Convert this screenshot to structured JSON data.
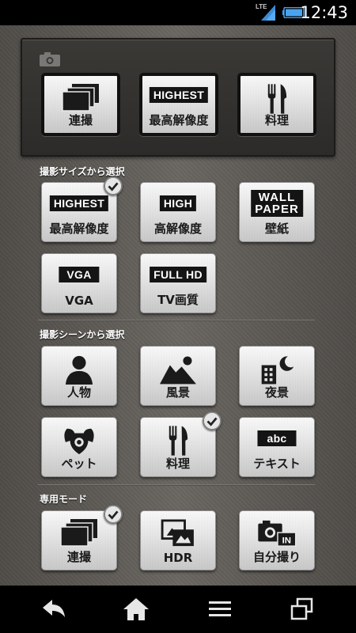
{
  "status_bar": {
    "network": "LTE",
    "time": "12:43"
  },
  "recent": {
    "items": [
      {
        "label": "連撮",
        "icon": "burst-icon"
      },
      {
        "label": "最高解像度",
        "tag": "HIGHEST"
      },
      {
        "label": "料理",
        "icon": "fork-knife-icon"
      }
    ]
  },
  "size_section": {
    "title": "撮影サイズから選択",
    "items": [
      {
        "label": "最高解像度",
        "tag": "HIGHEST",
        "selected": true
      },
      {
        "label": "高解像度",
        "tag": "HIGH"
      },
      {
        "label": "壁紙",
        "tag_line1": "WALL",
        "tag_line2": "PAPER"
      },
      {
        "label": "VGA",
        "tag": "VGA"
      },
      {
        "label": "TV画質",
        "tag": "FULL HD"
      }
    ]
  },
  "scene_section": {
    "title": "撮影シーンから選択",
    "items": [
      {
        "label": "人物",
        "icon": "person-icon"
      },
      {
        "label": "風景",
        "icon": "landscape-icon"
      },
      {
        "label": "夜景",
        "icon": "night-view-icon"
      },
      {
        "label": "ペット",
        "icon": "pet-icon"
      },
      {
        "label": "料理",
        "icon": "fork-knife-icon",
        "selected": true
      },
      {
        "label": "テキスト",
        "tag": "abc"
      }
    ]
  },
  "special_section": {
    "title": "専用モード",
    "items": [
      {
        "label": "連撮",
        "icon": "burst-icon",
        "selected": true
      },
      {
        "label": "HDR",
        "icon": "hdr-icon"
      },
      {
        "label": "自分撮り",
        "icon": "selfie-icon",
        "tag": "IN"
      }
    ]
  },
  "colors": {
    "background": "#5a5753",
    "panel": "#2d2b29",
    "button_light": "#fafafa",
    "button_dark": "#c8c8c8",
    "tag": "#141414"
  }
}
